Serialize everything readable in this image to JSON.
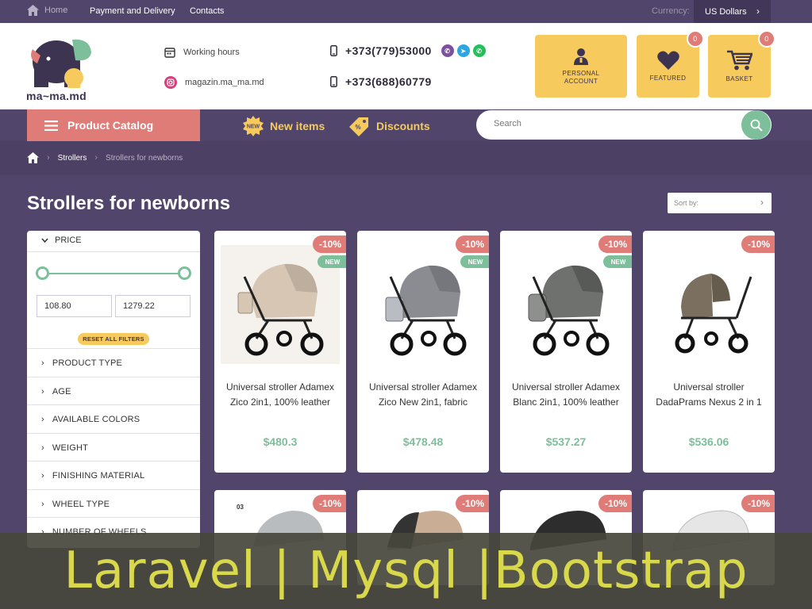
{
  "topbar": {
    "home": "Home",
    "nav": [
      "Payment and Delivery",
      "Contacts"
    ],
    "currency_label": "Currency:",
    "currency_value": "US Dollars"
  },
  "header": {
    "logo_text": "ma~ma.md",
    "working_hours": "Working hours",
    "instagram": "magazin.ma_ma.md",
    "phone1": "+373(779)53000",
    "phone2": "+373(688)60779",
    "account_label": "PERSONAL ACCOUNT",
    "featured_label": "FEATURED",
    "featured_count": "0",
    "basket_label": "BASKET",
    "basket_count": "0"
  },
  "nav": {
    "catalog": "Product Catalog",
    "new_items": "New items",
    "new_icon_text": "NEW",
    "discounts": "Discounts",
    "search_placeholder": "Search"
  },
  "breadcrumb": [
    "Strollers",
    "Strollers for newborns"
  ],
  "page_title": "Strollers for newborns",
  "sort_label": "Sort by:",
  "filters": {
    "price_label": "PRICE",
    "min": "108.80",
    "max": "1279.22",
    "reset": "RESET ALL FILTERS",
    "items": [
      "PRODUCT TYPE",
      "AGE",
      "AVAILABLE COLORS",
      "WEIGHT",
      "FINISHING MATERIAL",
      "WHEEL TYPE",
      "NUMBER OF WHEELS"
    ]
  },
  "products": [
    {
      "name": "Universal stroller Adamex Zico 2in1, 100% leather",
      "price": "$480.3",
      "discount": "-10%",
      "badge": "NEW",
      "color": "#d8c6b4"
    },
    {
      "name": "Universal stroller Adamex Zico New 2in1, fabric",
      "price": "$478.48",
      "discount": "-10%",
      "badge": "NEW",
      "color": "#8a8c92"
    },
    {
      "name": "Universal stroller Adamex Blanc 2in1, 100% leather",
      "price": "$537.27",
      "discount": "-10%",
      "badge": "NEW",
      "color": "#6f716f"
    },
    {
      "name": "Universal stroller DadaPrams Nexus 2 in 1",
      "price": "$536.06",
      "discount": "-10%",
      "badge": "",
      "color": "#7b705f"
    }
  ],
  "products_row2": [
    {
      "discount": "-10%",
      "color": "#b9bcbf",
      "label": "03"
    },
    {
      "discount": "-10%",
      "color": "#c9ad95",
      "label": ""
    },
    {
      "discount": "-10%",
      "color": "#2d2d2d",
      "label": ""
    },
    {
      "discount": "-10%",
      "color": "#e6e6e6",
      "label": ""
    }
  ],
  "colors": {
    "purple": "#51456b",
    "coral": "#e07c77",
    "yellow": "#f6ca5c",
    "green": "#7cbf9a"
  },
  "overlay_text": "Laravel | Mysql |Bootstrap"
}
